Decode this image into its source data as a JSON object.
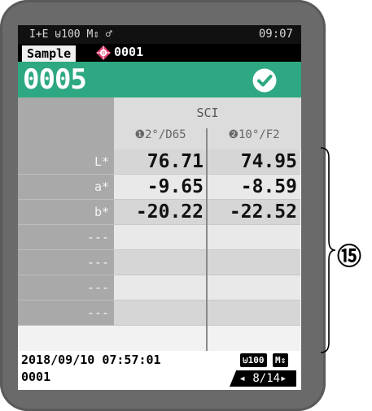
{
  "statusbar": {
    "icons_text": "I+E ⊎100 M⇕ ♂",
    "time": "09:07"
  },
  "sample": {
    "tab_label": "Sample",
    "number": "0001"
  },
  "measurement": {
    "number": "0005",
    "status_icon": "check-circle-icon",
    "accent_color": "#2ea882"
  },
  "table": {
    "header": "SCI",
    "columns": [
      "❶2°/D65",
      "❷10°/F2"
    ],
    "rows": [
      {
        "label": "L*",
        "v1": "76.71",
        "v2": "74.95"
      },
      {
        "label": "a*",
        "v1": "-9.65",
        "v2": "-8.59"
      },
      {
        "label": "b*",
        "v1": "-20.22",
        "v2": "-22.52"
      },
      {
        "label": "---",
        "v1": "",
        "v2": ""
      },
      {
        "label": "---",
        "v1": "",
        "v2": ""
      },
      {
        "label": "---",
        "v1": "",
        "v2": ""
      },
      {
        "label": "---",
        "v1": "",
        "v2": ""
      }
    ]
  },
  "footer": {
    "datetime": "2018/09/10 07:57:01",
    "id": "0001",
    "badge_uv": "⊎100",
    "badge_mode": "M⇕",
    "pager": "◂ 8/14▸"
  },
  "annotation": {
    "callout": "⑮"
  }
}
